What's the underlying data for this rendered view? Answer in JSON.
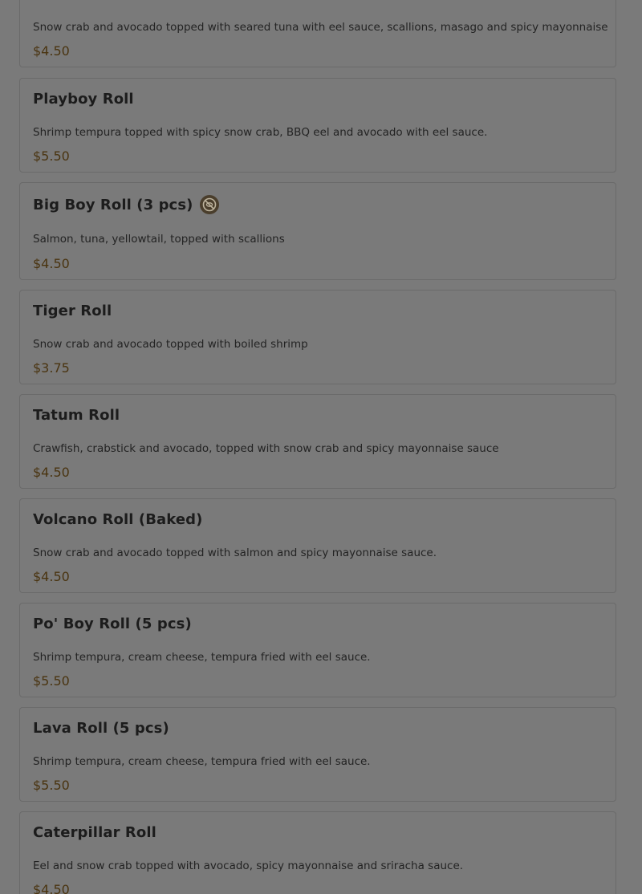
{
  "items": [
    {
      "title": "",
      "desc": "Snow crab and avocado topped with seared tuna with eel sauce, scallions, masago and spicy mayonnaise",
      "price": "$4.50"
    },
    {
      "title": "Playboy Roll",
      "desc": "Shrimp tempura topped with spicy snow crab, BBQ eel and avocado with eel sauce.",
      "price": "$5.50"
    },
    {
      "title": "Big Boy Roll (3 pcs)",
      "desc": "Salmon, tuna, yellowtail, topped with scallions",
      "price": "$4.50",
      "icon": "no-raw-fish-icon"
    },
    {
      "title": "Tiger Roll",
      "desc": "Snow crab and avocado topped with boiled shrimp",
      "price": "$3.75"
    },
    {
      "title": "Tatum Roll",
      "desc": "Crawfish, crabstick and avocado, topped with snow crab and spicy mayonnaise sauce",
      "price": "$4.50"
    },
    {
      "title": "Volcano Roll (Baked)",
      "desc": "Snow crab and avocado topped with salmon and spicy mayonnaise sauce.",
      "price": "$4.50"
    },
    {
      "title": "Po' Boy Roll (5 pcs)",
      "desc": "Shrimp tempura, cream cheese, tempura fried with eel sauce.",
      "price": "$5.50"
    },
    {
      "title": "Lava Roll (5 pcs)",
      "desc": "Shrimp tempura, cream cheese, tempura fried with eel sauce.",
      "price": "$5.50"
    },
    {
      "title": "Caterpillar Roll",
      "desc": "Eel and snow crab topped with avocado, spicy mayonnaise and sriracha sauce.",
      "price": "$4.50"
    }
  ],
  "colors": {
    "overlay": "#7a7a7a",
    "price": "#4a3410",
    "text": "#1c1c1c"
  }
}
